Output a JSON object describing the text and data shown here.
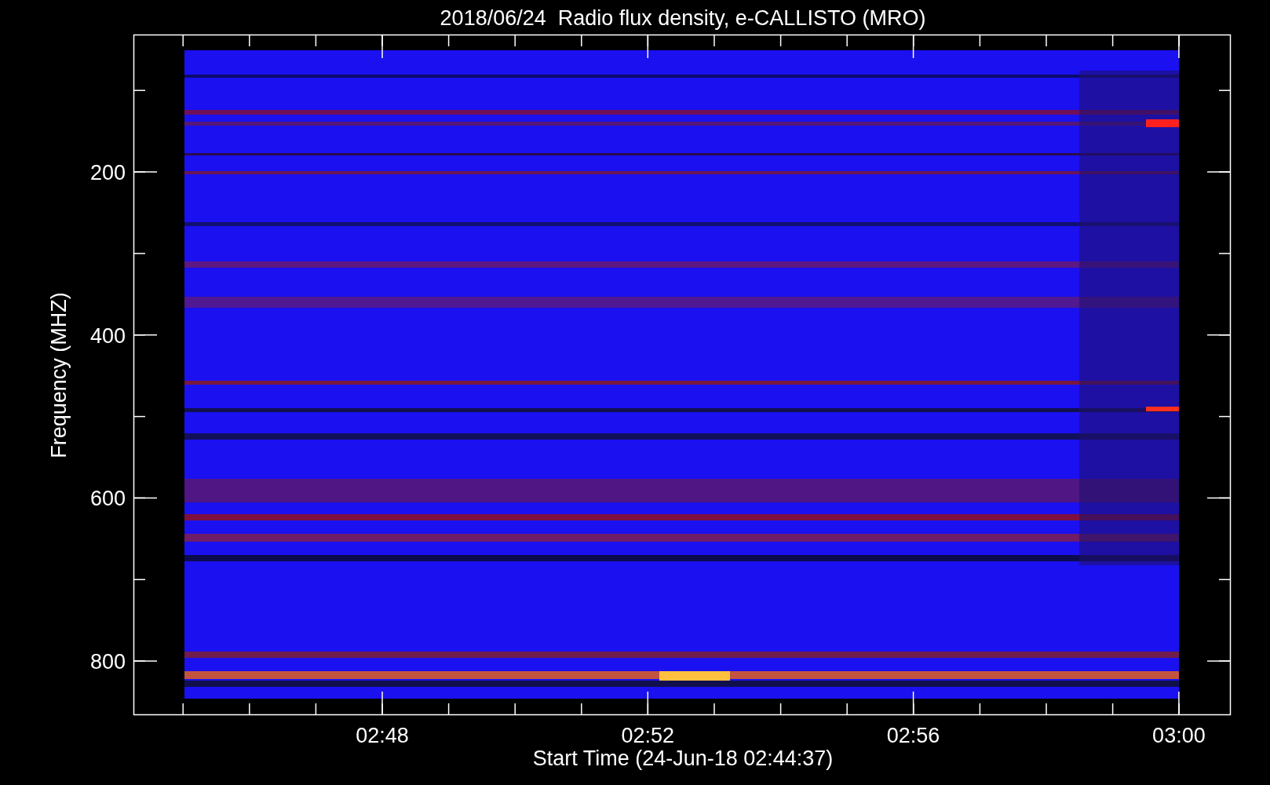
{
  "title": "2018/06/24  Radio flux density, e-CALLISTO (MRO)",
  "ylabel": "Frequency (MHZ)",
  "yticks": [
    "200",
    "400",
    "600",
    "800"
  ],
  "xticks": [
    "02:48",
    "02:52",
    "02:56",
    "03:00"
  ],
  "xlabel": "Start Time (24-Jun-18 02:44:37)"
}
